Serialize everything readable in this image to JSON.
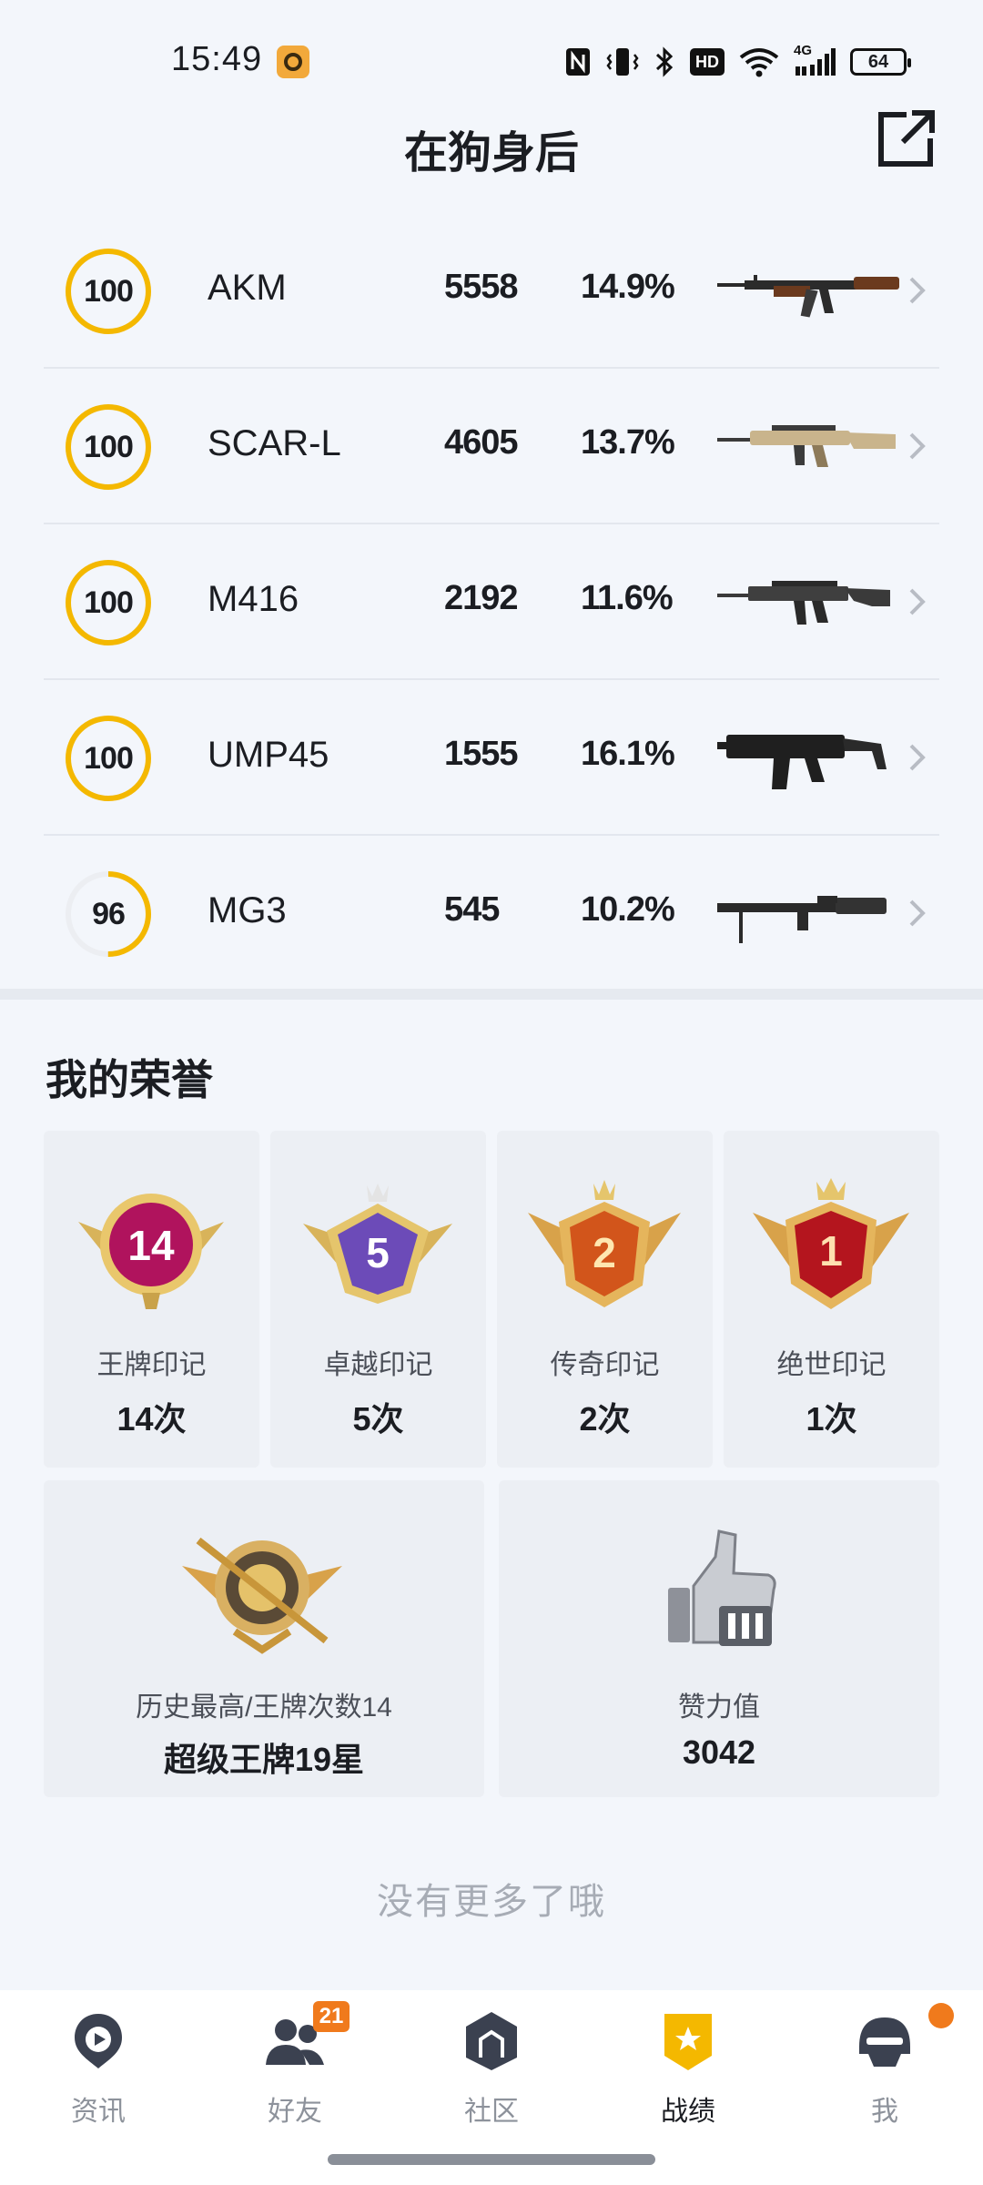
{
  "status_bar": {
    "time": "15:49",
    "icons": [
      "nfc-icon",
      "vibrate-icon",
      "bluetooth-icon",
      "hd-icon",
      "wifi-icon",
      "signal-4g-icon",
      "battery-icon"
    ],
    "hd_label": "HD",
    "network_label": "4G",
    "battery": "64"
  },
  "header": {
    "title": "在狗身后",
    "share_icon": "share-external-icon"
  },
  "weapons": [
    {
      "rating": "100",
      "progress": 1.0,
      "name": "AKM",
      "kills": "5558",
      "rate": "14.9%",
      "image": "akm-rifle-image"
    },
    {
      "rating": "100",
      "progress": 1.0,
      "name": "SCAR-L",
      "kills": "4605",
      "rate": "13.7%",
      "image": "scar-l-rifle-image"
    },
    {
      "rating": "100",
      "progress": 1.0,
      "name": "M416",
      "kills": "2192",
      "rate": "11.6%",
      "image": "m416-rifle-image"
    },
    {
      "rating": "100",
      "progress": 1.0,
      "name": "UMP45",
      "kills": "1555",
      "rate": "16.1%",
      "image": "ump45-smg-image"
    },
    {
      "rating": "96",
      "progress": 0.5,
      "name": "MG3",
      "kills": "545",
      "rate": "10.2%",
      "image": "mg3-lmg-image"
    }
  ],
  "honors": {
    "title": "我的荣誉",
    "badges": [
      {
        "badge_number": "14",
        "label": "王牌印记",
        "count": "14次",
        "color": "#b0135d"
      },
      {
        "badge_number": "5",
        "label": "卓越印记",
        "count": "5次",
        "color": "#6c4bb8"
      },
      {
        "badge_number": "2",
        "label": "传奇印记",
        "count": "2次",
        "color": "#d2551b"
      },
      {
        "badge_number": "1",
        "label": "绝世印记",
        "count": "1次",
        "color": "#b4151e"
      }
    ],
    "history": {
      "label": "历史最高/王牌次数14",
      "value": "超级王牌19星"
    },
    "likes": {
      "label": "赞力值",
      "value": "3042"
    }
  },
  "footer_text": "没有更多了哦",
  "nav": {
    "items": [
      {
        "label": "资讯",
        "icon": "news-play-icon"
      },
      {
        "label": "好友",
        "icon": "friends-icon",
        "badge": "21"
      },
      {
        "label": "社区",
        "icon": "community-icon"
      },
      {
        "label": "战绩",
        "icon": "record-badge-icon",
        "active": true
      },
      {
        "label": "我",
        "icon": "helmet-profile-icon",
        "dot": true
      }
    ]
  },
  "colors": {
    "accent": "#f4b800",
    "nav_badge": "#f07a1c",
    "page_bg": "#f3f6fb"
  }
}
